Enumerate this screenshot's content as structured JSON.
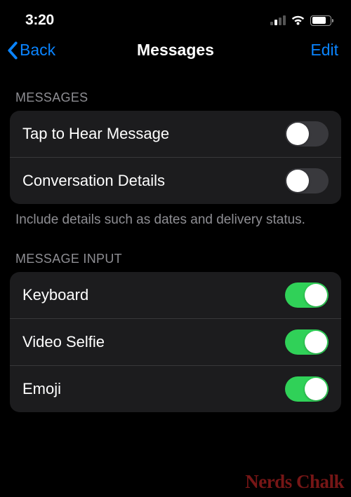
{
  "statusBar": {
    "time": "3:20"
  },
  "nav": {
    "back": "Back",
    "title": "Messages",
    "edit": "Edit"
  },
  "sections": {
    "messages": {
      "header": "Messages",
      "rows": [
        {
          "label": "Tap to Hear Message",
          "on": false
        },
        {
          "label": "Conversation Details",
          "on": false
        }
      ],
      "footer": "Include details such as dates and delivery status."
    },
    "input": {
      "header": "Message Input",
      "rows": [
        {
          "label": "Keyboard",
          "on": true
        },
        {
          "label": "Video Selfie",
          "on": true
        },
        {
          "label": "Emoji",
          "on": true
        }
      ]
    }
  },
  "watermark": "Nerds Chalk"
}
